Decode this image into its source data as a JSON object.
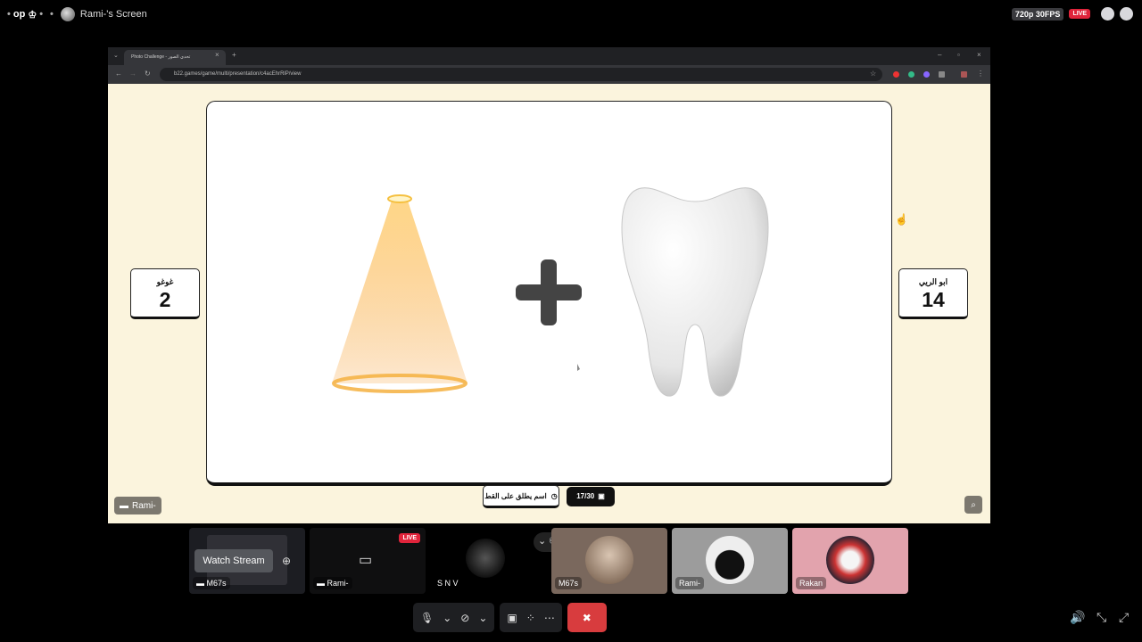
{
  "topbar": {
    "server_label": "op",
    "crown_glyph": "♔",
    "sharer": "Rami-'s Screen",
    "quality": "720p 30FPS",
    "live": "LIVE"
  },
  "browser": {
    "tab_title": "Photo Challenge - تحدي الصور",
    "url": "b22.games/game/multi/presentation/c4acEhrRlP/view"
  },
  "game": {
    "left_team": {
      "name": "غوغو",
      "score": "2"
    },
    "right_team": {
      "name": "ابو الريي",
      "score": "14"
    },
    "hint_label": "اسم يطلق على القط",
    "progress": "17/30",
    "operator": "+",
    "images": [
      "light-cone-image",
      "tooth-image"
    ]
  },
  "presenter_chip": "Rami-",
  "tiles": [
    {
      "label": "M67s",
      "action": "Watch Stream"
    },
    {
      "label": "Rami-",
      "badge": "LIVE"
    },
    {
      "label": "S N V"
    },
    {
      "label": "M67s"
    },
    {
      "label": "Rami-"
    },
    {
      "label": "Rakan"
    }
  ]
}
